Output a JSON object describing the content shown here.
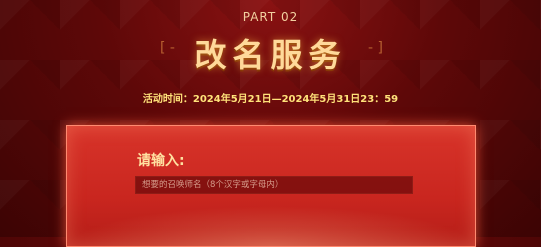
{
  "header": {
    "part_label": "PART 02",
    "title": "改名服务",
    "bracket_left": "[ -",
    "bracket_right": "- ]"
  },
  "event_time": "活动时间：2024年5月21日—2024年5月31日23：59",
  "form": {
    "label": "请输入:",
    "placeholder": "想要的召唤师名（8个汉字或字母内）",
    "value": ""
  },
  "colors": {
    "background": "#5e0808",
    "title": "#ffd99a",
    "time_text": "#ffe27a",
    "panel": "#d8342a",
    "input_bg": "#6e0a0a"
  }
}
